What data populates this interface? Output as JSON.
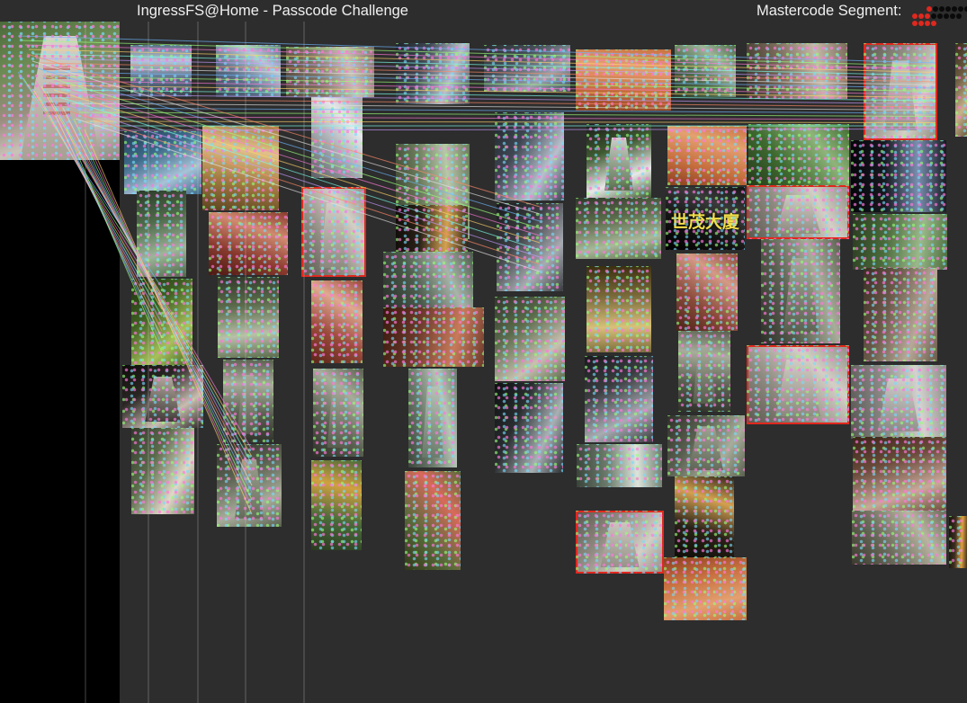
{
  "app": {
    "title": "IngressFS@Home - Passcode Challenge",
    "segment_label": "Mastercode Segment:"
  },
  "colors": {
    "background": "#2d2d2d",
    "selected_border": "#e0281e",
    "text": "#f0f0f0"
  },
  "mastercode_segment": {
    "rows": [
      [
        "red",
        "black",
        "black",
        "black",
        "black",
        "black",
        "black",
        "black"
      ],
      [
        "red",
        "red",
        "red",
        "black",
        "black",
        "black",
        "black",
        "black"
      ],
      [
        "red",
        "red",
        "red",
        "red"
      ]
    ]
  },
  "reference_image": {
    "subject": "stone-monument"
  },
  "candidates": [
    {
      "subject": "street",
      "selected": false
    },
    {
      "subject": "street",
      "selected": false
    },
    {
      "subject": "sculpture",
      "selected": false
    },
    {
      "subject": "clock-tower",
      "selected": false
    },
    {
      "subject": "street-scene",
      "selected": false
    },
    {
      "subject": "orange-building",
      "selected": false
    },
    {
      "subject": "plaza",
      "selected": false
    },
    {
      "subject": "building",
      "selected": false
    },
    {
      "subject": "stone-monument",
      "selected": true
    },
    {
      "subject": "mural",
      "selected": false
    },
    {
      "subject": "shrine",
      "selected": false
    },
    {
      "subject": "white-building",
      "selected": false
    },
    {
      "subject": "apartment",
      "selected": false
    },
    {
      "subject": "clock-tower",
      "selected": false
    },
    {
      "subject": "panda-statue",
      "selected": false
    },
    {
      "subject": "orange-building",
      "selected": false
    },
    {
      "subject": "garden",
      "selected": false
    },
    {
      "subject": "neon-sculpture",
      "selected": false
    },
    {
      "subject": "shrine-bottles",
      "selected": false
    },
    {
      "subject": "plaza",
      "selected": false
    },
    {
      "subject": "gate",
      "selected": false
    },
    {
      "subject": "stone-monument",
      "selected": true
    },
    {
      "subject": "night-building",
      "selected": false
    },
    {
      "subject": "train",
      "selected": false
    },
    {
      "subject": "fence",
      "selected": false
    },
    {
      "subject": "building-sign",
      "selected": false,
      "sign_text": "世茂大廈"
    },
    {
      "subject": "stone-monument",
      "selected": true
    },
    {
      "subject": "park",
      "selected": false
    },
    {
      "subject": "lantern",
      "selected": false
    },
    {
      "subject": "bridge",
      "selected": false
    },
    {
      "subject": "flower-cart",
      "selected": false
    },
    {
      "subject": "fountain",
      "selected": false
    },
    {
      "subject": "red-frame",
      "selected": false
    },
    {
      "subject": "garden-sign",
      "selected": false
    },
    {
      "subject": "snail-sculpture",
      "selected": false
    },
    {
      "subject": "red-building",
      "selected": false
    },
    {
      "subject": "stone-pillar",
      "selected": false
    },
    {
      "subject": "lantern-post",
      "selected": false
    },
    {
      "subject": "lion-statue",
      "selected": false
    },
    {
      "subject": "stone-pillar",
      "selected": false
    },
    {
      "subject": "stone-pillar",
      "selected": false
    },
    {
      "subject": "statue",
      "selected": false
    },
    {
      "subject": "shop",
      "selected": false
    },
    {
      "subject": "train",
      "selected": false
    },
    {
      "subject": "stone-pillar",
      "selected": false
    },
    {
      "subject": "stone-monument",
      "selected": true
    },
    {
      "subject": "stone-carving",
      "selected": false
    },
    {
      "subject": "arch-shrine",
      "selected": false
    },
    {
      "subject": "stone-pillar",
      "selected": false
    },
    {
      "subject": "garden-bench",
      "selected": false
    },
    {
      "subject": "red-flowers",
      "selected": false
    },
    {
      "subject": "sign-board",
      "selected": false
    },
    {
      "subject": "stone-pillar",
      "selected": false
    },
    {
      "subject": "house",
      "selected": false
    },
    {
      "subject": "night-building",
      "selected": false
    },
    {
      "subject": "deer-sculpture",
      "selected": false
    },
    {
      "subject": "bus",
      "selected": false
    },
    {
      "subject": "stone-monument",
      "selected": true
    },
    {
      "subject": "orange-building",
      "selected": false
    }
  ]
}
